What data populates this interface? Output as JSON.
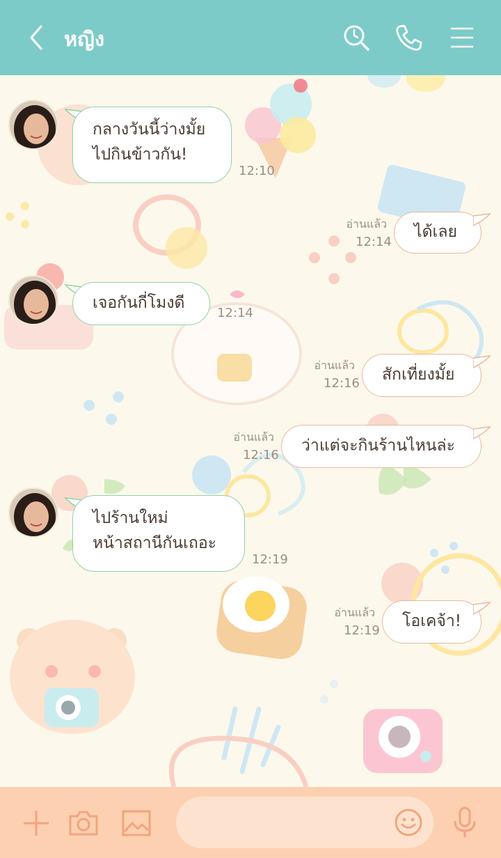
{
  "header": {
    "title": "หญิง",
    "icons": [
      "back-icon",
      "search-icon",
      "phone-icon",
      "menu-icon"
    ]
  },
  "messages": [
    {
      "side": "in",
      "lines": [
        "กลางวันนี้ว่างมั้ย",
        "ไปกินข้าวกัน!"
      ],
      "time": "12:10"
    },
    {
      "side": "out",
      "lines": [
        "ได้เลย"
      ],
      "read": "อ่านแล้ว",
      "time": "12:14"
    },
    {
      "side": "in",
      "lines": [
        "เจอกันกี่โมงดี"
      ],
      "time": "12:14"
    },
    {
      "side": "out",
      "lines": [
        "สักเที่ยงมั้ย"
      ],
      "read": "อ่านแล้ว",
      "time": "12:16"
    },
    {
      "side": "out",
      "lines": [
        "ว่าแต่จะกินร้านไหนล่ะ"
      ],
      "read": "อ่านแล้ว",
      "time": "12:16"
    },
    {
      "side": "in",
      "lines": [
        "ไปร้านใหม่",
        "หน้าสถานีกันเถอะ"
      ],
      "time": "12:19"
    },
    {
      "side": "out",
      "lines": [
        "โอเคจ้า!"
      ],
      "read": "อ่านแล้ว",
      "time": "12:19"
    }
  ],
  "footer": {
    "icons": [
      "plus-icon",
      "camera-icon",
      "image-icon",
      "emoji-icon",
      "microphone-icon"
    ],
    "input_placeholder": ""
  },
  "colors": {
    "header": "#7ccbc9",
    "background": "#fdf8ec",
    "footer": "#fcd0b1",
    "incoming_border": "#8fd3a8",
    "outgoing_border": "#e9b89c"
  }
}
